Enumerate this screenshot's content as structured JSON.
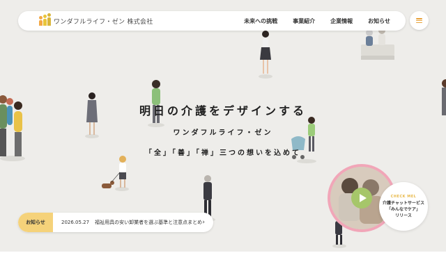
{
  "brand": {
    "logo_text": "ワンダフルライフ・ゼン 株式会社"
  },
  "nav": [
    {
      "label": "未来への挑戦"
    },
    {
      "label": "事業紹介"
    },
    {
      "label": "企業情報"
    },
    {
      "label": "お知らせ"
    }
  ],
  "menu": {
    "icon": "hamburger-icon"
  },
  "hero": {
    "headline": "明日の介護をデザインする",
    "company": "ワンダフルライフ・ゼン",
    "philosophy": "「全」「善」「禅」三つの想いを込めて"
  },
  "news": {
    "label": "お知らせ",
    "date": "2026.05.27",
    "title": "福祉用具の安い卸業者を選ぶ基準と注意点まとめ",
    "arrow_icon": "chevron-right-icon"
  },
  "promo": {
    "kicker": "CHECK MEL",
    "line1": "介護チャットサービス",
    "line2": "「みんなでケア」",
    "line3": "リリース",
    "play_icon": "play-icon"
  },
  "colors": {
    "accent": "#f5d27a",
    "hero_bg": "#eeedea",
    "play": "#a6c66a",
    "promo_border": "#f1a6b8"
  }
}
